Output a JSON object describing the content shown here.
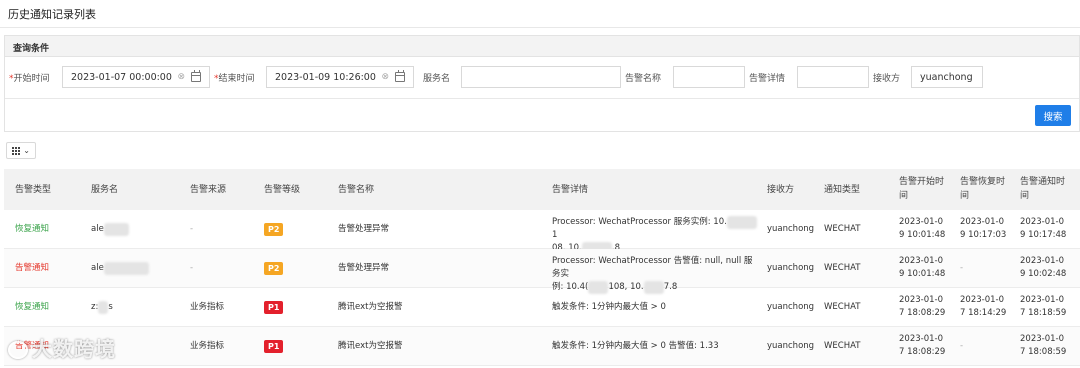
{
  "page": {
    "title": "历史通知记录列表"
  },
  "query": {
    "header": "查询条件",
    "start_label": "开始时间",
    "start_value": "2023-01-07 00:00:00",
    "end_label": "结束时间",
    "end_value": "2023-01-09 10:26:00",
    "service_label": "服务名",
    "service_value": "",
    "alert_name_label": "告警名称",
    "alert_name_value": "",
    "alert_detail_label": "告警详情",
    "alert_detail_value": "",
    "receiver_label": "接收方",
    "receiver_value": "yuanchong",
    "required_mark": "*",
    "clear_glyph": "⊗",
    "search_button": "搜索"
  },
  "toolbar": {
    "column_icon": "grid-icon",
    "chevron": "⌄"
  },
  "table": {
    "columns": {
      "type": "告警类型",
      "service": "服务名",
      "source": "告警来源",
      "level": "告警等级",
      "name": "告警名称",
      "detail": "告警详情",
      "receiver": "接收方",
      "notify_type": "通知类型",
      "start_time": "告警开始时间",
      "recover_time": "告警恢复时间",
      "notify_time": "告警通知时间"
    },
    "rows": [
      {
        "type": "恢复通知",
        "type_color": "#3aa34a",
        "service": "ale",
        "source": "-",
        "level": "P2",
        "level_color": "#f5a623",
        "name": "告警处理异常",
        "detail_1": "Processor: WechatProcessor 服务实例: 10.",
        "detail_1b": "1",
        "detail_2": "08, 10.",
        "detail_2b": ".8",
        "receiver": "yuanchong",
        "notify_type": "WECHAT",
        "start_1": "2023-01-0",
        "start_2": "9 10:01:48",
        "recover_1": "2023-01-0",
        "recover_2": "9 10:17:03",
        "notify_1": "2023-01-0",
        "notify_2": "9 10:17:48"
      },
      {
        "type": "告警通知",
        "type_color": "#e5382d",
        "service": "ale",
        "source": "-",
        "level": "P2",
        "level_color": "#f5a623",
        "name": "告警处理异常",
        "detail_1": "Processor: WechatProcessor 告警值: null, null 服务实",
        "detail_2": "例: 10.4(",
        "detail_2b": "108, 10.",
        "detail_2c": "7.8",
        "receiver": "yuanchong",
        "notify_type": "WECHAT",
        "start_1": "2023-01-0",
        "start_2": "9 10:01:48",
        "recover_1": "-",
        "recover_2": "",
        "notify_1": "2023-01-0",
        "notify_2": "9 10:02:48"
      },
      {
        "type": "恢复通知",
        "type_color": "#3aa34a",
        "service": "z:",
        "service_b": "s",
        "source": "业务指标",
        "level": "P1",
        "level_color": "#e3202c",
        "name": "腾讯ext为空报警",
        "detail_1": "触发条件: 1分钟内最大值 > 0",
        "receiver": "yuanchong",
        "notify_type": "WECHAT",
        "start_1": "2023-01-0",
        "start_2": "7 18:08:29",
        "recover_1": "2023-01-0",
        "recover_2": "7 18:14:29",
        "notify_1": "2023-01-0",
        "notify_2": "7 18:18:59"
      },
      {
        "type": "告警通知",
        "type_color": "#e5382d",
        "service": "",
        "source": "业务指标",
        "level": "P1",
        "level_color": "#e3202c",
        "name": "腾讯ext为空报警",
        "detail_1": "触发条件: 1分钟内最大值 > 0 告警值: 1.33",
        "receiver": "yuanchong",
        "notify_type": "WECHAT",
        "start_1": "2023-01-0",
        "start_2": "7 18:08:29",
        "recover_1": "-",
        "recover_2": "",
        "notify_1": "2023-01-0",
        "notify_2": "7 18:08:59"
      }
    ]
  },
  "watermark": {
    "text": "大数跨境",
    "icon": "chat-bubble-icon"
  }
}
